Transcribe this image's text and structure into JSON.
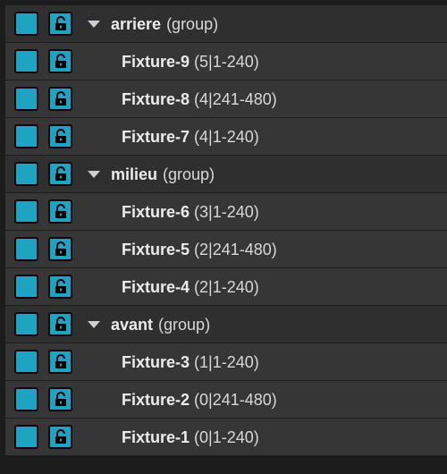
{
  "colors": {
    "toggle": "#1fa3c3",
    "row_bg": "#373737",
    "text": "#e6e6e6"
  },
  "icons": {
    "visibility": "visibility-square-icon",
    "lock": "padlock-open-icon",
    "expand": "triangle-down-icon"
  },
  "rows": [
    {
      "type": "group",
      "name": "arriere",
      "detail": "(group)"
    },
    {
      "type": "fixture",
      "name": "Fixture-9",
      "detail": "(5|1-240)"
    },
    {
      "type": "fixture",
      "name": "Fixture-8",
      "detail": "(4|241-480)"
    },
    {
      "type": "fixture",
      "name": "Fixture-7",
      "detail": "(4|1-240)"
    },
    {
      "type": "group",
      "name": "milieu",
      "detail": "(group)"
    },
    {
      "type": "fixture",
      "name": "Fixture-6",
      "detail": "(3|1-240)"
    },
    {
      "type": "fixture",
      "name": "Fixture-5",
      "detail": "(2|241-480)"
    },
    {
      "type": "fixture",
      "name": "Fixture-4",
      "detail": "(2|1-240)"
    },
    {
      "type": "group",
      "name": "avant",
      "detail": "(group)"
    },
    {
      "type": "fixture",
      "name": "Fixture-3",
      "detail": "(1|1-240)"
    },
    {
      "type": "fixture",
      "name": "Fixture-2",
      "detail": "(0|241-480)"
    },
    {
      "type": "fixture",
      "name": "Fixture-1",
      "detail": "(0|1-240)"
    }
  ]
}
